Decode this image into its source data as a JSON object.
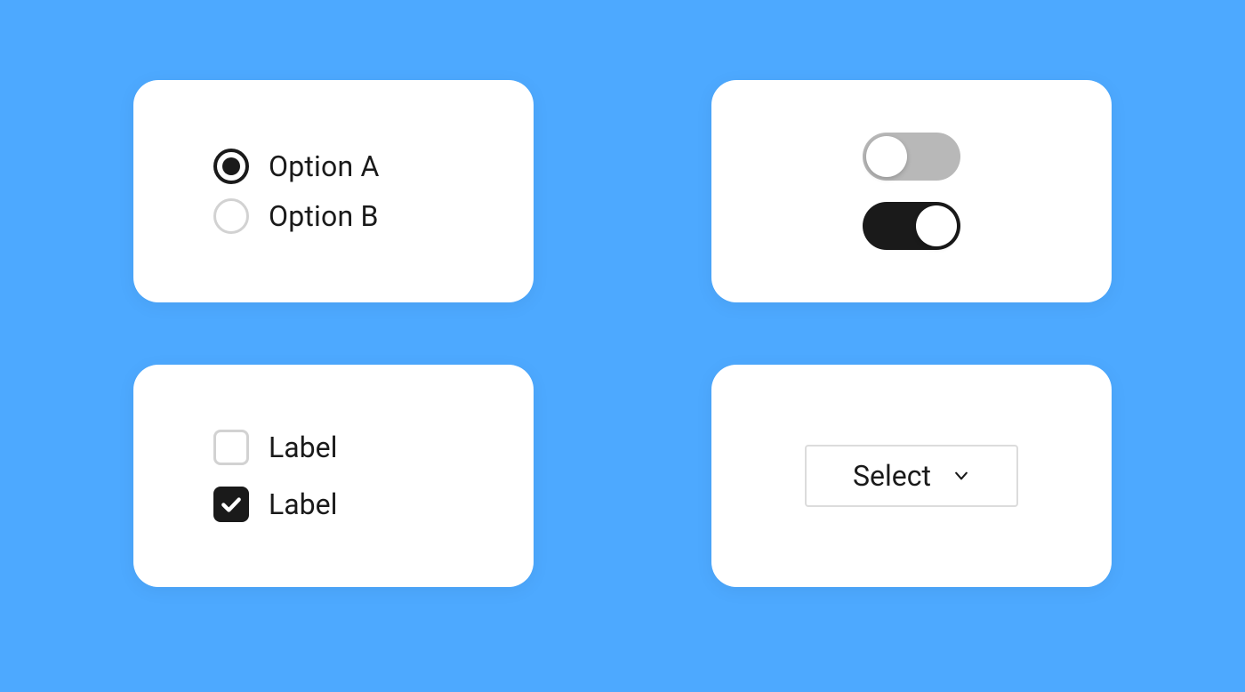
{
  "radios": {
    "options": [
      {
        "label": "Option A",
        "selected": true
      },
      {
        "label": "Option B",
        "selected": false
      }
    ]
  },
  "checkboxes": {
    "items": [
      {
        "label": "Label",
        "checked": false
      },
      {
        "label": "Label",
        "checked": true
      }
    ]
  },
  "toggles": {
    "items": [
      {
        "state": "off"
      },
      {
        "state": "on"
      }
    ]
  },
  "select": {
    "value": "Select"
  },
  "colors": {
    "background": "#4DA9FF",
    "card": "#ffffff",
    "ink": "#1a1a1a",
    "muted_border": "#d2d2d2",
    "toggle_off": "#b8b8b8"
  }
}
